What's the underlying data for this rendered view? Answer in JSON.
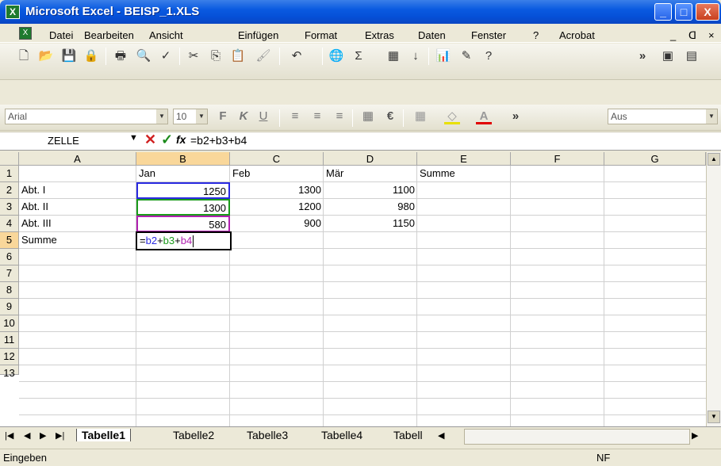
{
  "window": {
    "title": "Microsoft Excel - BEISP_1.XLS",
    "app_icon": "excel-icon",
    "minimize": "_",
    "maximize": "□",
    "close": "X"
  },
  "menu": [
    "Datei",
    "Bearbeiten",
    "Ansicht",
    "Einfügen",
    "Format",
    "Extras",
    "Daten",
    "Fenster",
    "?",
    "Acrobat"
  ],
  "menu_doc_controls": {
    "minimize": "_",
    "restore": "ᗡ",
    "close": "×"
  },
  "toolbar_format": {
    "font": "Arial",
    "size": "10",
    "bold": "F",
    "italic": "K",
    "underline": "U",
    "euro": "€",
    "chevron": "»",
    "aus": "Aus"
  },
  "formula_bar": {
    "name_box": "ZELLE",
    "cancel": "✕",
    "enter": "✓",
    "fx": "fx",
    "formula": "=b2+b3+b4"
  },
  "columns": [
    "A",
    "B",
    "C",
    "D",
    "E",
    "F",
    "G"
  ],
  "rows": [
    "1",
    "2",
    "3",
    "4",
    "5",
    "6",
    "7",
    "8",
    "9",
    "10",
    "11",
    "12",
    "13"
  ],
  "cells": {
    "b1": "Jan",
    "c1": "Feb",
    "d1": "Mär",
    "e1": "Summe",
    "a2": "Abt. I",
    "b2": "1250",
    "c2": "1300",
    "d2": "1100",
    "a3": "Abt. II",
    "b3": "1300",
    "c3": "1200",
    "d3": "980",
    "a4": "Abt. III",
    "b4": "580",
    "c4": "900",
    "d4": "1150",
    "a5": "Summe"
  },
  "edit_formula": {
    "eq": "=",
    "r1": "b2",
    "p1": "+",
    "r2": "b3",
    "p2": "+",
    "r3": "b4"
  },
  "ref_colors": {
    "b2": "#2a2ae0",
    "b3": "#1a9a1a",
    "b4": "#b020b0"
  },
  "sheet_tabs": [
    "Tabelle1",
    "Tabelle2",
    "Tabelle3",
    "Tabelle4",
    "Tabell"
  ],
  "status": {
    "mode": "Eingeben",
    "nf": "NF"
  }
}
